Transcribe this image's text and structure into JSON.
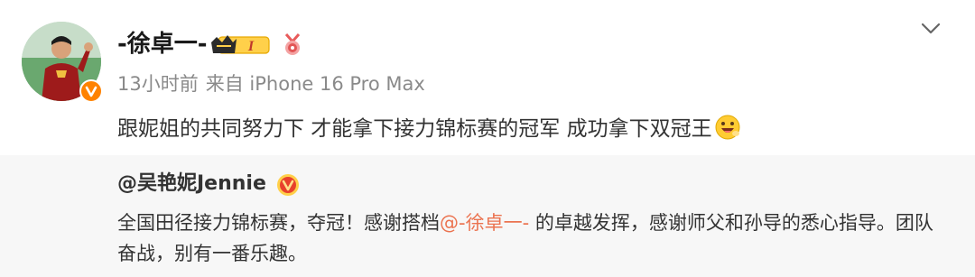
{
  "post": {
    "username": "-徐卓一-",
    "level_badge": "I",
    "time": "13小时前",
    "source": "来自 iPhone 16 Pro Max",
    "text": "跟妮姐的共同努力下 才能拿下接力锦标赛的冠军 成功拿下双冠王"
  },
  "repost": {
    "author": "@吴艳妮Jennie",
    "text_before": "全国田径接力锦标赛，夺冠！感谢搭档",
    "mention": "@-徐卓一-",
    "text_after": " 的卓越发挥，感谢师父和孙导的悉心指导。团队奋战，别有一番乐趣。"
  },
  "colors": {
    "accent": "#ff8200",
    "mention": "#eb7350",
    "meta": "#8a8a8a",
    "repost_bg": "#f7f7f7"
  },
  "icons": [
    "verified-icon",
    "crown-level-icon",
    "medal-icon",
    "chevron-down-icon",
    "grinning-emoji-icon"
  ]
}
